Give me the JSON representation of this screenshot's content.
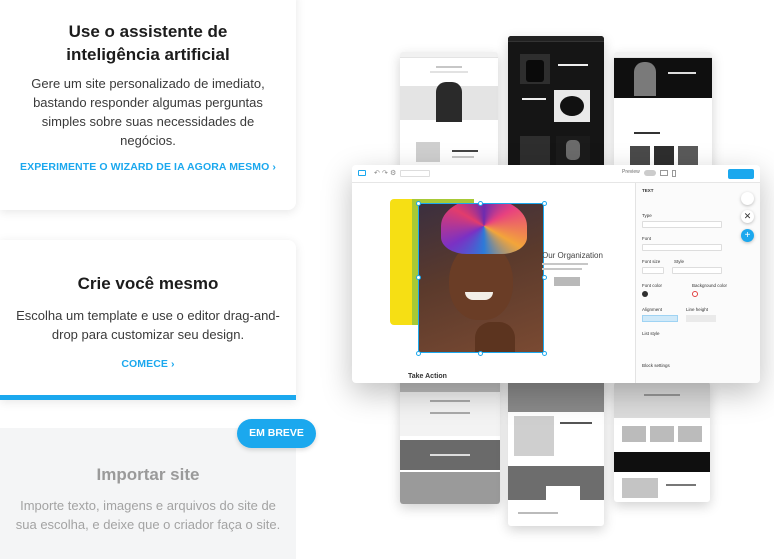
{
  "cards": {
    "ai": {
      "title": "Use o assistente de inteligência artificial",
      "description": "Gere um site personalizado de imediato, bastando responder algumas perguntas simples sobre suas necessidades de negócios.",
      "link": "EXPERIMENTE O WIZARD DE IA AGORA MESMO ›"
    },
    "self": {
      "title": "Crie você mesmo",
      "description": "Escolha um template e use o editor drag-and-drop para customizar seu design.",
      "link": "COMECE ›"
    },
    "import": {
      "badge": "EM BREVE",
      "title": "Importar site",
      "description": "Importe texto, imagens e arquivos do site de sua escolha, e deixe que o criador faça o site."
    }
  },
  "colors": {
    "accent": "#1ba8ee",
    "muted_text": "#9a9a9a",
    "yellow": "#f6df14",
    "green": "#a7c936"
  },
  "editor_preview": {
    "heading_text": "Our Organization",
    "section_text": "Take Action",
    "panel": {
      "title": "TEXT",
      "type_label": "Type",
      "type_value": "Heading 1",
      "font_label": "Font",
      "font_value": "Playfair Display",
      "font_size_label": "Font size",
      "style_label": "Style",
      "font_color_label": "Font color",
      "font_color_value": "#2F2F2F",
      "bg_color_label": "Background color",
      "bg_color_value": "Transparent",
      "alignment_label": "Alignment",
      "line_height_label": "Line height",
      "list_style_label": "List style",
      "block_settings_label": "Block settings"
    },
    "publish_label": "Publish",
    "preview_label": "Preview"
  }
}
